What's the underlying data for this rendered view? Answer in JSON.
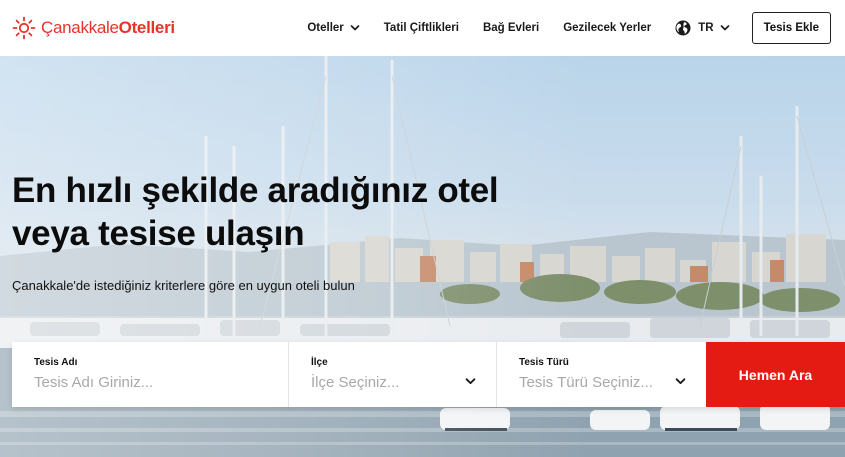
{
  "brand": {
    "name_part1": "Çanakkale",
    "name_part2": "Otelleri",
    "color": "#e8332a",
    "icon": "sun-icon"
  },
  "nav": {
    "items": [
      {
        "label": "Oteller",
        "has_dropdown": true
      },
      {
        "label": "Tatil Çiftlikleri",
        "has_dropdown": false
      },
      {
        "label": "Bağ Evleri",
        "has_dropdown": false
      },
      {
        "label": "Gezilecek Yerler",
        "has_dropdown": false
      }
    ],
    "language": {
      "label": "TR",
      "icon": "globe-icon"
    },
    "cta_label": "Tesis Ekle"
  },
  "hero": {
    "headline_line1": "En hızlı şekilde aradığınız otel",
    "headline_line2": "veya tesise ulaşın",
    "subheadline": "Çanakkale'de istediğiniz kriterlere göre en uygun oteli bulun"
  },
  "search": {
    "name_label": "Tesis Adı",
    "name_placeholder": "Tesis Adı Giriniz...",
    "district_label": "İlçe",
    "district_value": "İlçe Seçiniz...",
    "type_label": "Tesis Türü",
    "type_value": "Tesis Türü Seçiniz...",
    "submit_label": "Hemen Ara",
    "submit_color": "#e41b13"
  }
}
